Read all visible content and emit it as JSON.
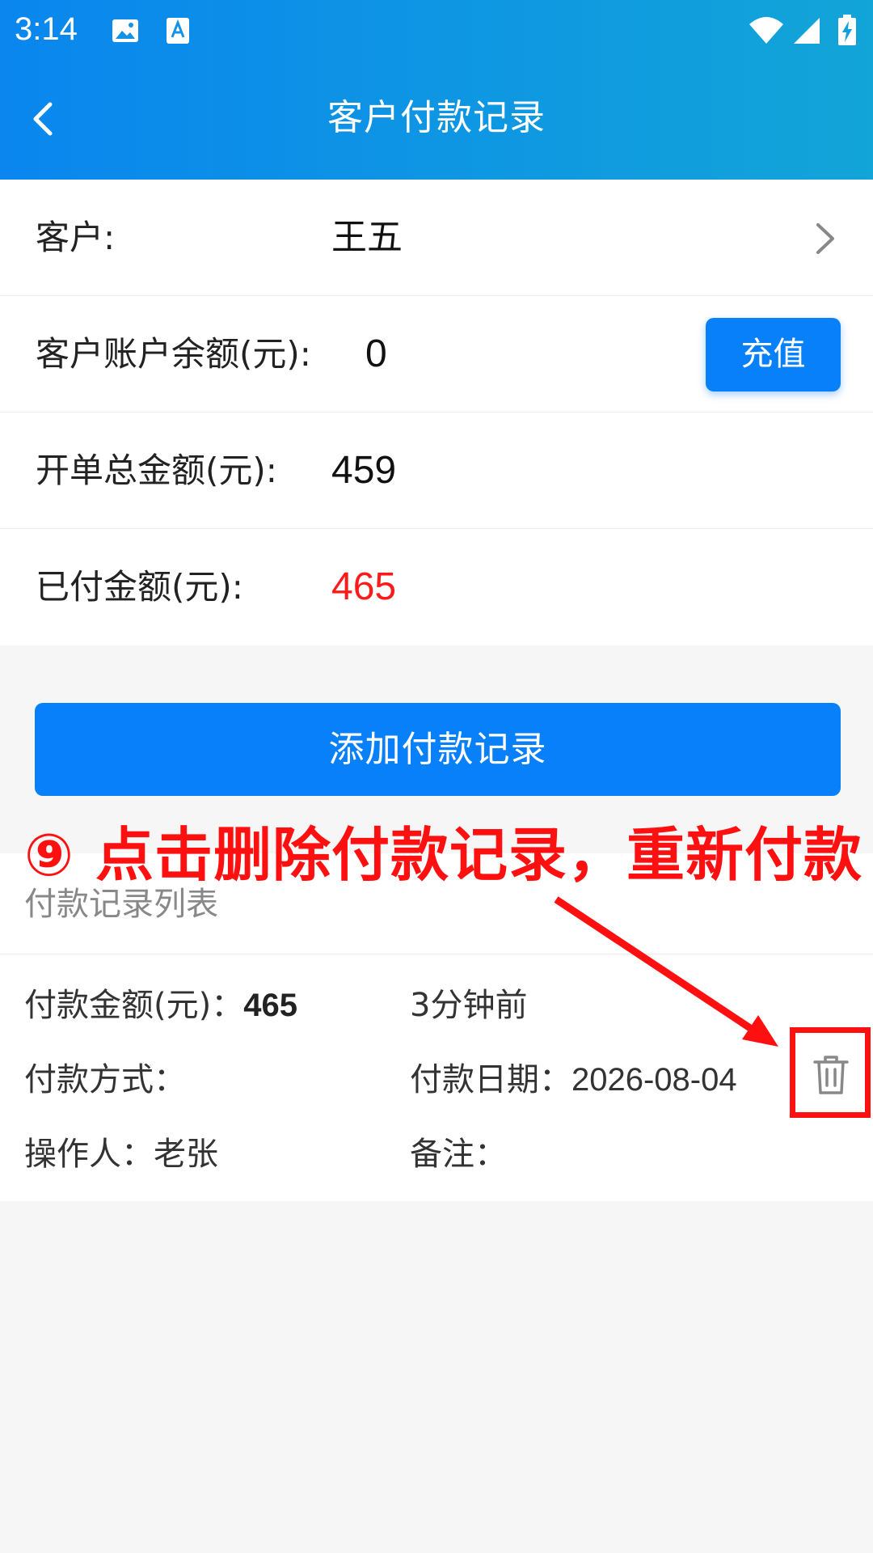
{
  "status_bar": {
    "time": "3:14",
    "icons": [
      "image-icon",
      "font-icon",
      "wifi-icon",
      "signal-icon",
      "battery-charging-icon"
    ]
  },
  "nav": {
    "title": "客户付款记录",
    "back_icon": "chevron-left-icon"
  },
  "info": {
    "customer_label": "客户:",
    "customer_value": "王五",
    "balance_label": "客户账户余额(元):",
    "balance_value": "0",
    "recharge_label": "充值",
    "total_label": "开单总金额(元):",
    "total_value": "459",
    "paid_label": "已付金额(元):",
    "paid_value": "465",
    "paid_color": "#ff1a1a"
  },
  "actions": {
    "add_payment_label": "添加付款记录"
  },
  "list": {
    "title": "付款记录列表",
    "records": [
      {
        "amount_label": "付款金额(元)：",
        "amount_value": "465",
        "time_ago": "3分钟前",
        "method_label": "付款方式：",
        "date_label": "付款日期：",
        "date_value": "2026-08-04",
        "operator_label": "操作人：",
        "operator_value": "老张",
        "note_label": "备注：",
        "delete_icon": "trash-icon"
      }
    ]
  },
  "annotation": {
    "text": "⑨ 点击删除付款记录，重新付款",
    "color": "#ff1010"
  },
  "colors": {
    "primary": "#0880f9",
    "header_gradient_start": "#0a86ee",
    "header_gradient_end": "#12a5d8",
    "background": "#f6f6f6"
  }
}
